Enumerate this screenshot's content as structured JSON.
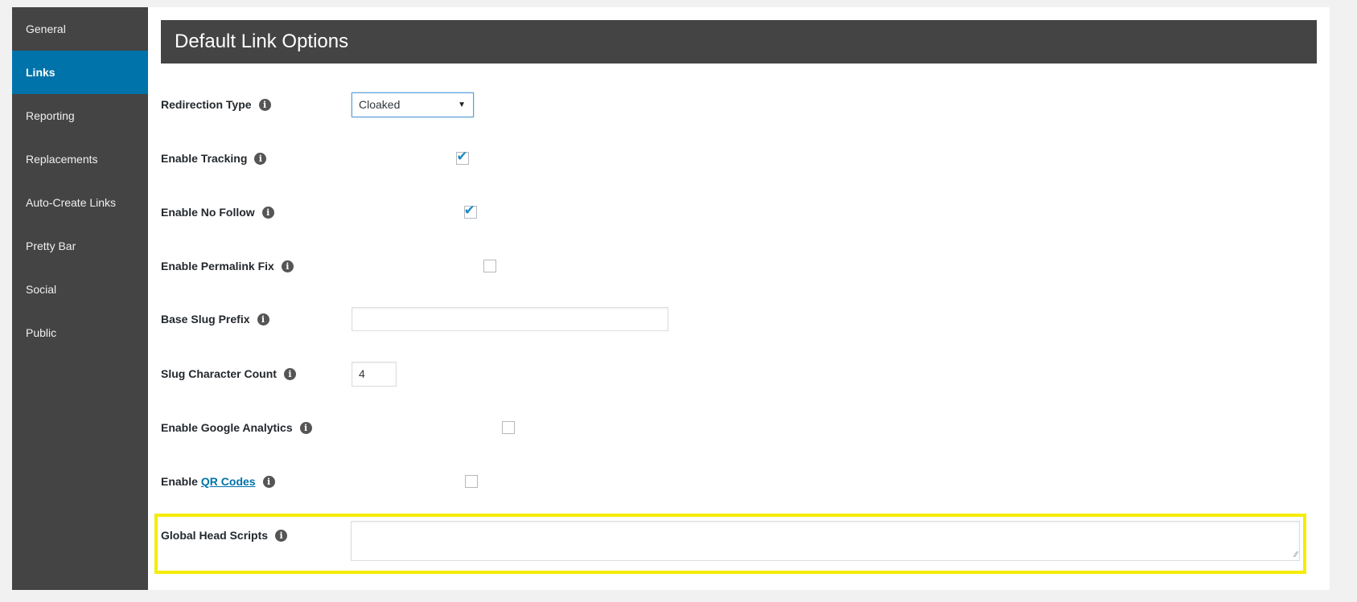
{
  "sidebar": {
    "items": [
      {
        "label": "General",
        "active": false
      },
      {
        "label": "Links",
        "active": true
      },
      {
        "label": "Reporting",
        "active": false
      },
      {
        "label": "Replacements",
        "active": false
      },
      {
        "label": "Auto-Create Links",
        "active": false
      },
      {
        "label": "Pretty Bar",
        "active": false
      },
      {
        "label": "Social",
        "active": false
      },
      {
        "label": "Public",
        "active": false
      }
    ]
  },
  "header": {
    "title": "Default Link Options"
  },
  "fields": {
    "redirection_type": {
      "label": "Redirection Type",
      "value": "Cloaked"
    },
    "enable_tracking": {
      "label": "Enable Tracking",
      "checked": true
    },
    "enable_no_follow": {
      "label": "Enable No Follow",
      "checked": true
    },
    "enable_permalink_fix": {
      "label": "Enable Permalink Fix",
      "checked": false
    },
    "base_slug_prefix": {
      "label": "Base Slug Prefix",
      "value": ""
    },
    "slug_character_count": {
      "label": "Slug Character Count",
      "value": "4"
    },
    "enable_google_analytics": {
      "label": "Enable Google Analytics",
      "checked": false
    },
    "enable_qr_codes": {
      "label_prefix": "Enable",
      "link_text": "QR Codes",
      "checked": false
    },
    "global_head_scripts": {
      "label": "Global Head Scripts",
      "value": ""
    }
  },
  "icons": {
    "info": "i",
    "check": "✔",
    "dropdown_arrow": "▼",
    "resize": "⁄⁄"
  },
  "colors": {
    "accent": "#0073aa",
    "highlight": "#f5ec00",
    "sidebar_bg": "#444444"
  }
}
